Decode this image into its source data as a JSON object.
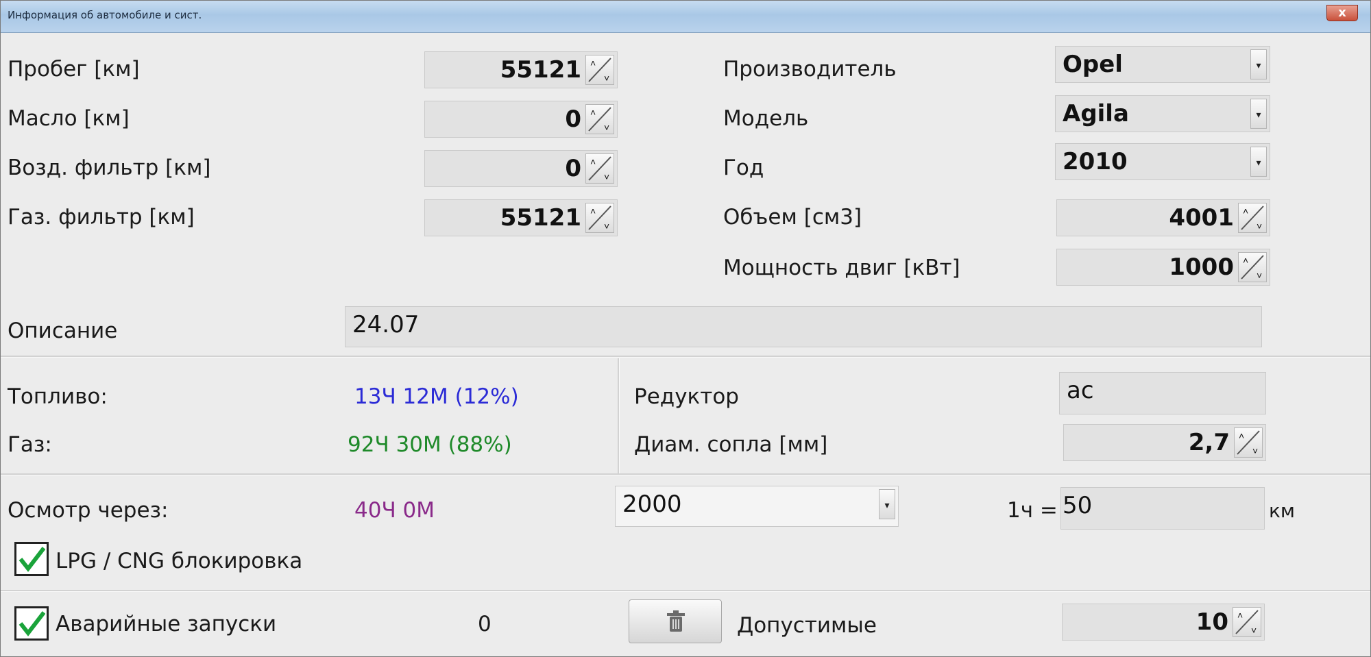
{
  "window": {
    "title": "Информация об автомобиле и сист.",
    "close_label": "x"
  },
  "counters": [
    {
      "label": "Пробег [км]",
      "value": "55121"
    },
    {
      "label": "Масло [км]",
      "value": "0"
    },
    {
      "label": "Возд. фильтр [км]",
      "value": "0"
    },
    {
      "label": "Газ. фильтр [км]",
      "value": "55121"
    }
  ],
  "vehicle": {
    "manufacturer_label": "Производитель",
    "manufacturer_value": "Opel",
    "model_label": "Модель",
    "model_value": "Agila",
    "year_label": "Год",
    "year_value": "2010",
    "volume_label": "Объем [см3]",
    "volume_value": "4001",
    "power_label": "Мощность двиг [кВт]",
    "power_value": "1000"
  },
  "description": {
    "label": "Описание",
    "value": "24.07"
  },
  "usage": {
    "fuel_label": "Топливо:",
    "fuel_value": "13Ч 12М (12%)",
    "fuel_color": "#2b2bd6",
    "gas_label": "Газ:",
    "gas_value": "92Ч 30М (88%)",
    "gas_color": "#1f8a2a"
  },
  "reducer": {
    "label": "Редуктор",
    "value": "ac",
    "nozzle_label": "Диам. сопла [мм]",
    "nozzle_value": "2,7"
  },
  "inspection": {
    "label": "Осмотр через:",
    "remaining": "40Ч  0М",
    "remaining_color": "#8a2a8a",
    "interval_value": "2000",
    "per_hour_label": "1ч =",
    "per_hour_value": "50",
    "unit": "км"
  },
  "lpg_lock": {
    "label": "LPG / CNG блокировка",
    "checked": true
  },
  "emergency": {
    "label": "Аварийные запуски",
    "checked": true,
    "count": "0",
    "allowed_label": "Допустимые",
    "allowed_value": "10"
  },
  "icons": {
    "spin": "spin-arrows-icon",
    "dropdown": "chevron-down-icon",
    "check": "checkmark-icon",
    "trash": "trash-icon"
  },
  "colors": {
    "check": "#1aa33a"
  }
}
